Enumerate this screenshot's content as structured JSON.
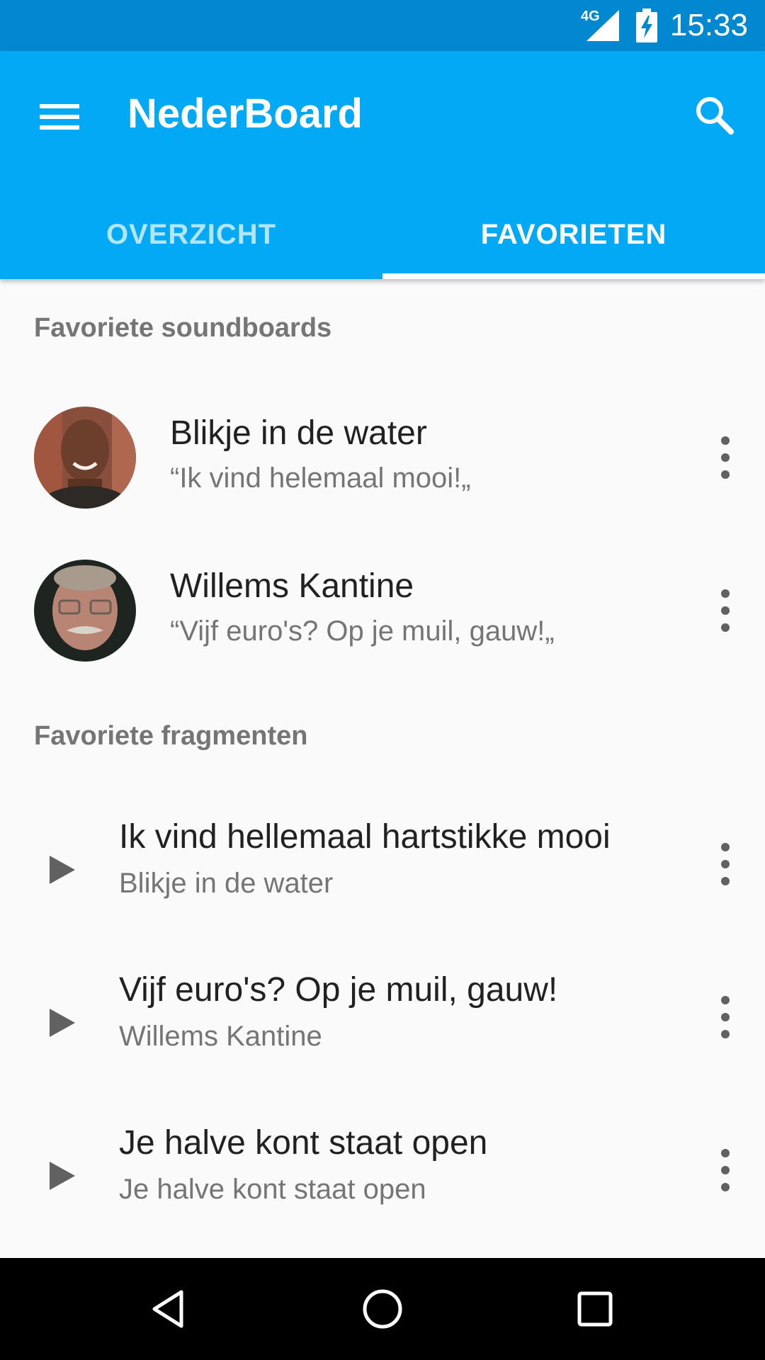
{
  "status_bar": {
    "network": "4G",
    "time": "15:33"
  },
  "app_bar": {
    "title": "NederBoard"
  },
  "tabs": [
    {
      "label": "OVERZICHT",
      "selected": false
    },
    {
      "label": "FAVORIETEN",
      "selected": true
    }
  ],
  "favorite_soundboards": {
    "header": "Favoriete soundboards",
    "items": [
      {
        "title": "Blikje in de water",
        "subtitle": "“Ik vind helemaal mooi!„"
      },
      {
        "title": "Willems Kantine",
        "subtitle": "“Vijf euro's? Op je muil, gauw!„"
      }
    ]
  },
  "favorite_fragments": {
    "header": "Favoriete fragmenten",
    "items": [
      {
        "title": "Ik vind hellemaal hartstikke mooi",
        "subtitle": "Blikje in de water"
      },
      {
        "title": "Vijf euro's? Op je muil, gauw!",
        "subtitle": "Willems Kantine"
      },
      {
        "title": "Je halve kont staat open",
        "subtitle": "Je halve kont staat open"
      }
    ]
  },
  "colors": {
    "primary": "#03a9f4",
    "primary_dark": "#0288d1",
    "tab_unselected": "#b3e5fc",
    "background": "#fafafa"
  },
  "icons": [
    "menu-icon",
    "search-icon",
    "more-vert-icon",
    "play-icon",
    "back-icon",
    "home-icon",
    "recents-icon",
    "signal-icon",
    "battery-icon"
  ]
}
